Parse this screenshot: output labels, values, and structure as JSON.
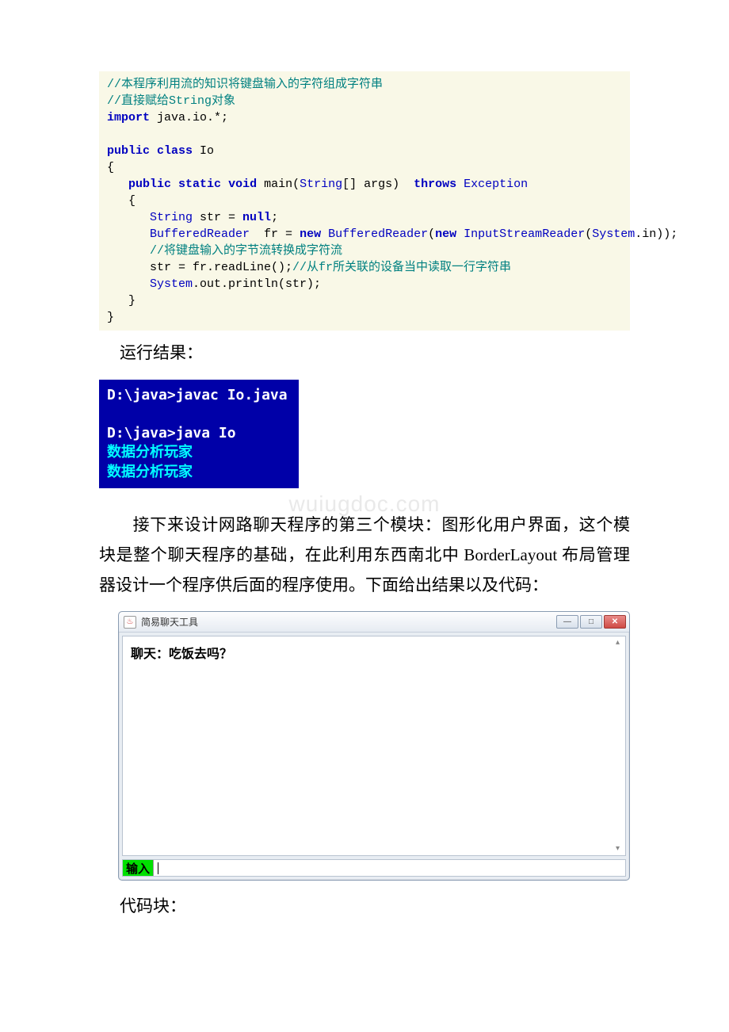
{
  "code": {
    "c1": "//本程序利用流的知识将键盘输入的字符组成字符串",
    "c2": "//直接赋给String对象",
    "imp_kw": "import",
    "imp_rest": " java.io.*;",
    "pub": "public",
    "cls_kw": "class",
    "cls_name": " Io",
    "lb": "{",
    "rb": "}",
    "indent1": "   ",
    "indent2": "      ",
    "static": "static",
    "void": "void",
    "main": " main(",
    "string_type": "String",
    "args": "[] args)  ",
    "throws": "throws",
    "exc": " Exception",
    "strdecl_type": "String",
    "strdecl_rest": " str = ",
    "null_kw": "null",
    "semi": ";",
    "br_type": "BufferedReader",
    "br_mid": "  fr = ",
    "new_kw": "new",
    "sp": " ",
    "br_type2": "BufferedReader",
    "lp": "(",
    "rp": ")",
    "isr_type": "InputStreamReader",
    "sys": "System",
    "in": ".in));",
    "c3": "//将键盘输入的字节流转换成字符流",
    "readline": "str = fr.readLine();",
    "c4": "//从fr所关联的设备当中读取一行字符串",
    "sysout": "System",
    "out": ".out.println(str);"
  },
  "label_run": "运行结果：",
  "terminal": {
    "l1a": "D:\\java>",
    "l1b": "javac Io.java",
    "blank": "",
    "l2a": "D:\\java>",
    "l2b": "java Io",
    "l3": "数据分析玩家",
    "l4": "数据分析玩家"
  },
  "paragraph": "接下来设计网路聊天程序的第三个模块：图形化用户界面，这个模块是整个聊天程序的基础，在此利用东西南北中 BorderLayout 布局管理器设计一个程序供后面的程序使用。下面给出结果以及代码：",
  "gui": {
    "title": "简易聊天工具",
    "java_glyph": "♨",
    "min": "—",
    "max": "□",
    "close": "✕",
    "chat_line": "聊天：吃饭去吗？",
    "input_label": "输入",
    "up": "▴",
    "dn": "▾"
  },
  "label_code": "代码块：",
  "watermark": "wuiugdoc.com"
}
